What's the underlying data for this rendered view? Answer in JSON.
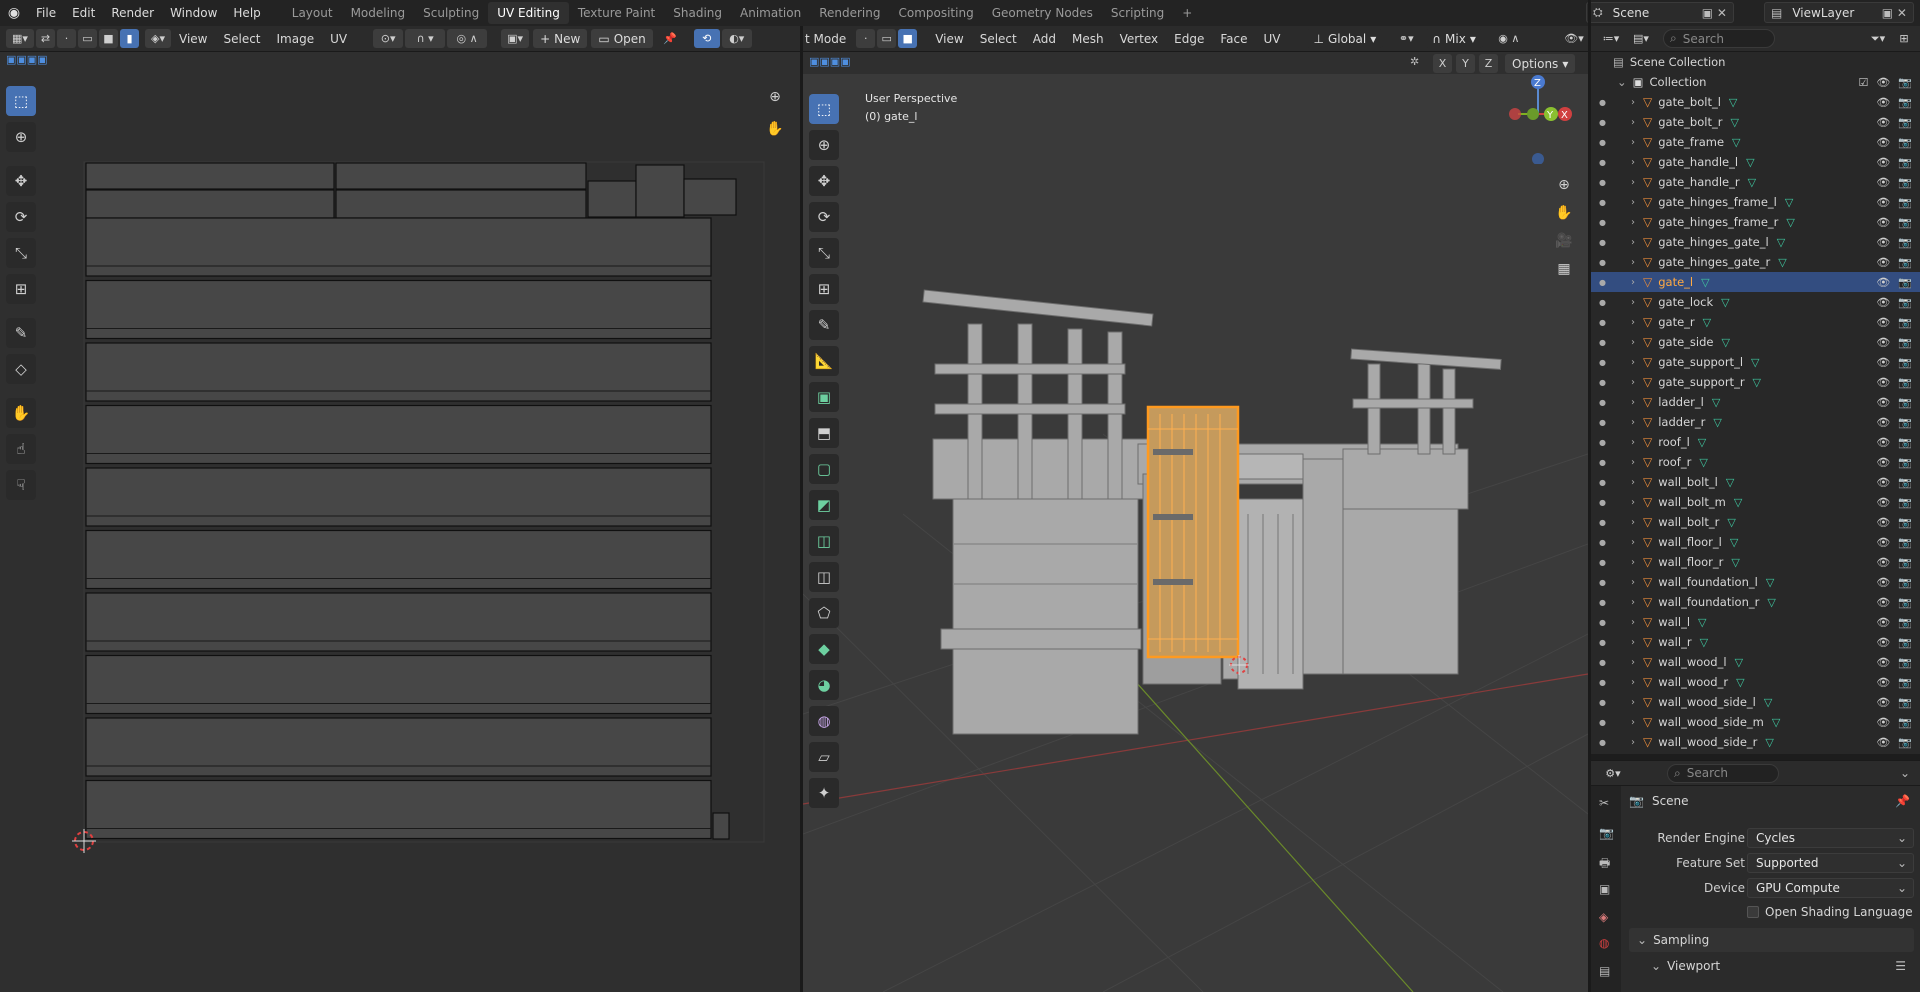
{
  "topbar": {
    "menus": [
      "File",
      "Edit",
      "Render",
      "Window",
      "Help"
    ],
    "workspaces": [
      "Layout",
      "Modeling",
      "Sculpting",
      "UV Editing",
      "Texture Paint",
      "Shading",
      "Animation",
      "Rendering",
      "Compositing",
      "Geometry Nodes",
      "Scripting"
    ],
    "active_workspace": "UV Editing",
    "scene": "Scene",
    "view_layer": "ViewLayer"
  },
  "uv_editor": {
    "menus": [
      "View",
      "Select",
      "Image",
      "UV"
    ],
    "new_label": "New",
    "open_label": "Open"
  },
  "viewport": {
    "mode": "t Mode",
    "menus": [
      "View",
      "Select",
      "Add",
      "Mesh",
      "Vertex",
      "Edge",
      "Face",
      "UV"
    ],
    "transform": "Global",
    "snap": "Mix",
    "axes": [
      "X",
      "Y",
      "Z"
    ],
    "options_label": "Options",
    "perspective_label": "User Perspective",
    "object_label": "(0) gate_l"
  },
  "outliner": {
    "search_placeholder": "Search",
    "scene_collection": "Scene Collection",
    "collection": "Collection",
    "items": [
      "gate_bolt_l",
      "gate_bolt_r",
      "gate_frame",
      "gate_handle_l",
      "gate_handle_r",
      "gate_hinges_frame_l",
      "gate_hinges_frame_r",
      "gate_hinges_gate_l",
      "gate_hinges_gate_r",
      "gate_l",
      "gate_lock",
      "gate_r",
      "gate_side",
      "gate_support_l",
      "gate_support_r",
      "ladder_l",
      "ladder_r",
      "roof_l",
      "roof_r",
      "wall_bolt_l",
      "wall_bolt_m",
      "wall_bolt_r",
      "wall_floor_l",
      "wall_floor_r",
      "wall_foundation_l",
      "wall_foundation_r",
      "wall_l",
      "wall_r",
      "wall_wood_l",
      "wall_wood_r",
      "wall_wood_side_l",
      "wall_wood_side_m",
      "wall_wood_side_r"
    ],
    "selected": "gate_l"
  },
  "properties": {
    "search_placeholder": "Search",
    "context": "Scene",
    "render_engine_label": "Render Engine",
    "render_engine": "Cycles",
    "feature_set_label": "Feature Set",
    "feature_set": "Supported",
    "device_label": "Device",
    "device": "GPU Compute",
    "osl_label": "Open Shading Language",
    "sampling_label": "Sampling",
    "viewport_label": "Viewport"
  }
}
